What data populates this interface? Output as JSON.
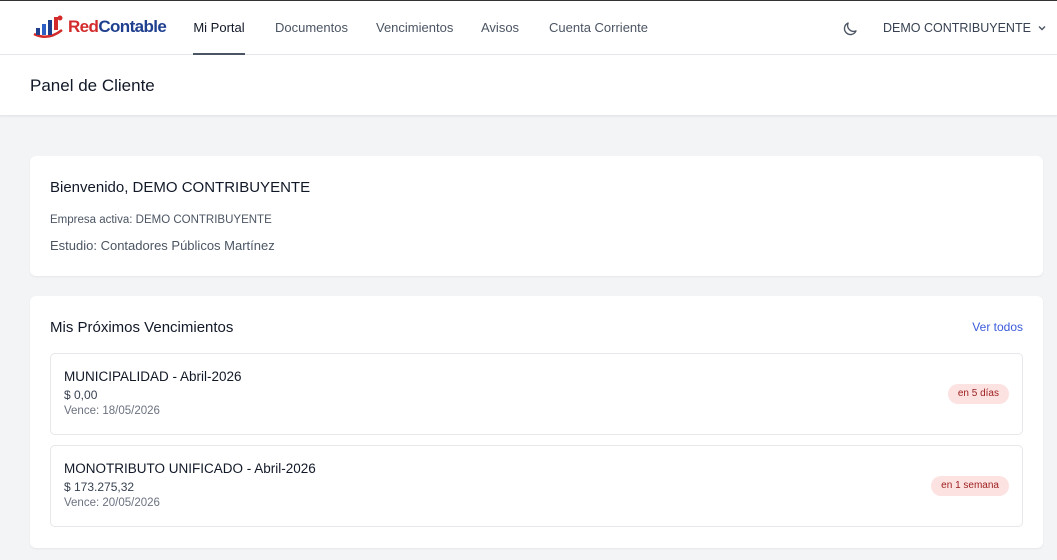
{
  "brand": {
    "part1": "Red",
    "part2": "Contable",
    "icon": "bar-chart-logo-icon"
  },
  "nav": {
    "items": [
      {
        "label": "Mi Portal",
        "active": true
      },
      {
        "label": "Documentos",
        "active": false
      },
      {
        "label": "Vencimientos",
        "active": false
      },
      {
        "label": "Avisos",
        "active": false
      },
      {
        "label": "Cuenta Corriente",
        "active": false
      }
    ],
    "theme_icon": "moon-icon",
    "user": {
      "name": "DEMO CONTRIBUYENTE",
      "icon": "chevron-down-icon"
    }
  },
  "header": {
    "title": "Panel de Cliente"
  },
  "welcome": {
    "title": "Bienvenido, DEMO CONTRIBUYENTE",
    "company": "Empresa activa: DEMO CONTRIBUYENTE",
    "studio": "Estudio: Contadores Públicos Martínez"
  },
  "due": {
    "title": "Mis Próximos Vencimientos",
    "view_all": "Ver todos",
    "items": [
      {
        "name": "MUNICIPALIDAD - Abril-2026",
        "amount": "$ 0,00",
        "date": "Vence: 18/05/2026",
        "badge": "en 5 días"
      },
      {
        "name": "MONOTRIBUTO UNIFICADO - Abril-2026",
        "amount": "$ 173.275,32",
        "date": "Vence: 20/05/2026",
        "badge": "en 1 semana"
      }
    ]
  },
  "colors": {
    "accent": "#3b5bdb",
    "brand_red": "#d32b2b",
    "brand_blue": "#1f3f8f",
    "badge_bg": "#fde2e2",
    "badge_text": "#9b1c1c"
  }
}
